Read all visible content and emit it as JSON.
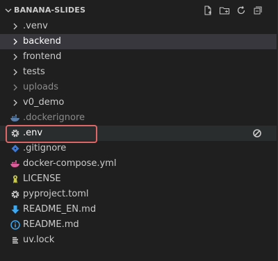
{
  "explorer": {
    "title": "BANANA-SLIDES",
    "actions": [
      "new-file-icon",
      "new-folder-icon",
      "refresh-icon",
      "collapse-all-icon"
    ]
  },
  "items": [
    {
      "label": ".venv",
      "kind": "folder",
      "icon": "chevron-right-icon"
    },
    {
      "label": "backend",
      "kind": "folder",
      "icon": "chevron-right-icon",
      "state": "selected"
    },
    {
      "label": "frontend",
      "kind": "folder",
      "icon": "chevron-right-icon"
    },
    {
      "label": "tests",
      "kind": "folder",
      "icon": "chevron-right-icon"
    },
    {
      "label": "uploads",
      "kind": "folder",
      "icon": "chevron-right-icon",
      "dim": true
    },
    {
      "label": "v0_demo",
      "kind": "folder",
      "icon": "chevron-right-icon"
    },
    {
      "label": ".dockerignore",
      "kind": "file",
      "icon": "docker-icon",
      "dim": true
    },
    {
      "label": ".env",
      "kind": "file",
      "icon": "gear-icon",
      "state": "active"
    },
    {
      "label": ".gitignore",
      "kind": "file",
      "icon": "git-diamond-icon"
    },
    {
      "label": "docker-compose.yml",
      "kind": "file",
      "icon": "docker-icon"
    },
    {
      "label": "LICENSE",
      "kind": "file",
      "icon": "license-icon"
    },
    {
      "label": "pyproject.toml",
      "kind": "file",
      "icon": "gear-icon"
    },
    {
      "label": "README_EN.md",
      "kind": "file",
      "icon": "download-arrow-icon"
    },
    {
      "label": "README.md",
      "kind": "file",
      "icon": "info-icon"
    },
    {
      "label": "uv.lock",
      "kind": "file",
      "icon": "lines-icon"
    }
  ],
  "colors": {
    "accent": "#e06767",
    "docker": "#4a90d9",
    "docker_pink": "#d9609a",
    "git": "#3e7bd6",
    "license": "#c9c94a",
    "info": "#3ea8f0"
  }
}
